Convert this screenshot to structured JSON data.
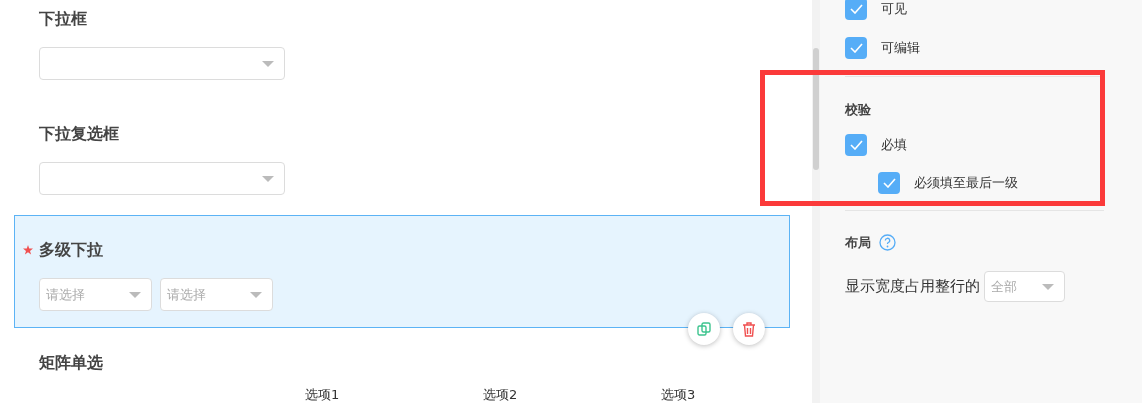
{
  "canvas": {
    "fields": [
      {
        "kind": "select",
        "label": "下拉框",
        "required": false,
        "selected": false
      },
      {
        "kind": "select",
        "label": "下拉复选框",
        "required": false,
        "selected": false
      },
      {
        "kind": "cascader",
        "label": "多级下拉",
        "required": true,
        "selected": true,
        "selects": [
          {
            "placeholder": "请选择"
          },
          {
            "placeholder": "请选择"
          }
        ]
      },
      {
        "kind": "matrix",
        "label": "矩阵单选",
        "required": false,
        "selected": false,
        "columns": [
          "选项1",
          "选项2",
          "选项3"
        ]
      }
    ]
  },
  "properties": {
    "options": [
      {
        "label": "可见",
        "checked": true
      },
      {
        "label": "可编辑",
        "checked": true
      }
    ],
    "validation": {
      "title": "校验",
      "options": [
        {
          "label": "必填",
          "checked": true,
          "children": [
            {
              "label": "必须填至最后一级",
              "checked": true
            }
          ]
        }
      ]
    },
    "layout": {
      "title": "布局",
      "width_label": "显示宽度占用整行的",
      "width_value": "全部"
    }
  }
}
